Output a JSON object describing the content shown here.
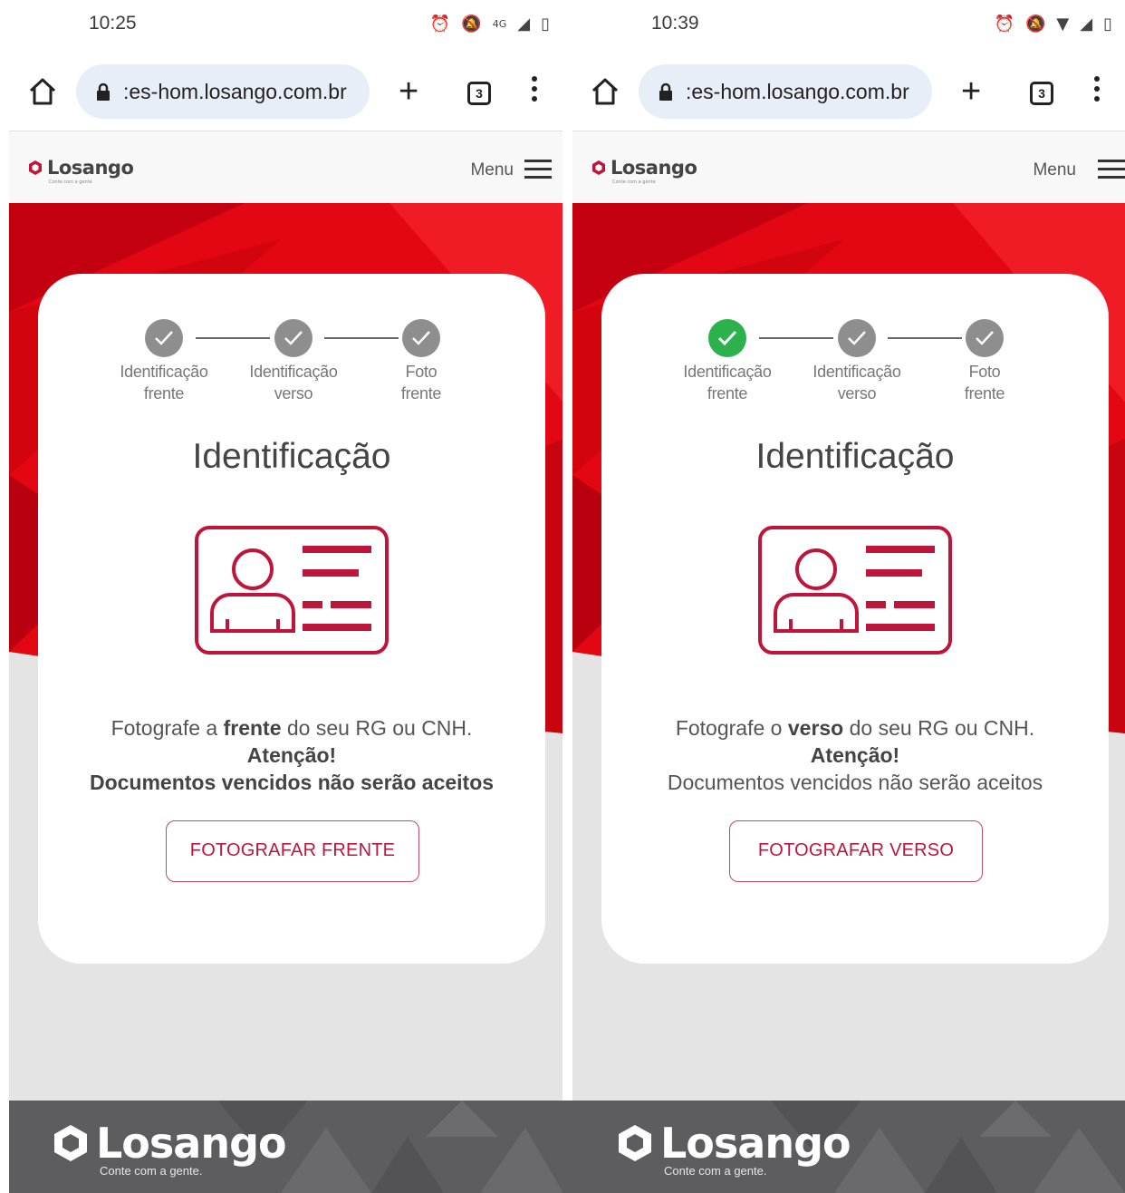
{
  "screens": [
    {
      "status": {
        "time": "10:25",
        "network": "4G"
      },
      "browser": {
        "url": ":es-hom.losango.com.br",
        "tab_count": "3"
      },
      "header": {
        "brand": "Losango",
        "tagline": "Conte com a gente",
        "menu_label": "Menu"
      },
      "steps": [
        {
          "line1": "Identificação",
          "line2": "frente",
          "state": "pending"
        },
        {
          "line1": "Identificação",
          "line2": "verso",
          "state": "pending"
        },
        {
          "line1": "Foto",
          "line2": "frente",
          "state": "pending"
        }
      ],
      "title": "Identificação",
      "instruction": {
        "pre": "Fotografe a ",
        "bold": "frente",
        "post": " do seu RG ou CNH.",
        "attention": "Atenção!",
        "warning": "Documentos vencidos não serão aceitos"
      },
      "button_label": "FOTOGRAFAR FRENTE",
      "footer": {
        "brand": "Losango",
        "tagline": "Conte com a gente."
      }
    },
    {
      "status": {
        "time": "10:39",
        "network": ""
      },
      "browser": {
        "url": ":es-hom.losango.com.br",
        "tab_count": "3"
      },
      "header": {
        "brand": "Losango",
        "tagline": "Conte com a gente",
        "menu_label": "Menu"
      },
      "steps": [
        {
          "line1": "Identificação",
          "line2": "frente",
          "state": "done"
        },
        {
          "line1": "Identificação",
          "line2": "verso",
          "state": "pending"
        },
        {
          "line1": "Foto",
          "line2": "frente",
          "state": "pending"
        }
      ],
      "title": "Identificação",
      "instruction": {
        "pre": "Fotografe o ",
        "bold": "verso",
        "post": " do seu RG ou CNH.",
        "attention": "Atenção!",
        "warning": "Documentos vencidos não serão aceitos"
      },
      "button_label": "FOTOGRAFAR VERSO",
      "footer": {
        "brand": "Losango",
        "tagline": "Conte com a gente."
      }
    }
  ],
  "colors": {
    "brand_red": "#c0153a",
    "hero_red": "#e30613",
    "step_done": "#2bb24c",
    "step_pending": "#8e8e8e",
    "footer_bg": "#5d5d60",
    "url_pill": "#e8eef7"
  },
  "icons": [
    "alarm-icon",
    "bell-off-icon",
    "signal-icon",
    "battery-icon",
    "wifi-icon",
    "home-icon",
    "lock-icon",
    "plus-icon",
    "tabs-icon",
    "more-vert-icon",
    "hamburger-icon",
    "check-icon",
    "id-card-icon"
  ]
}
